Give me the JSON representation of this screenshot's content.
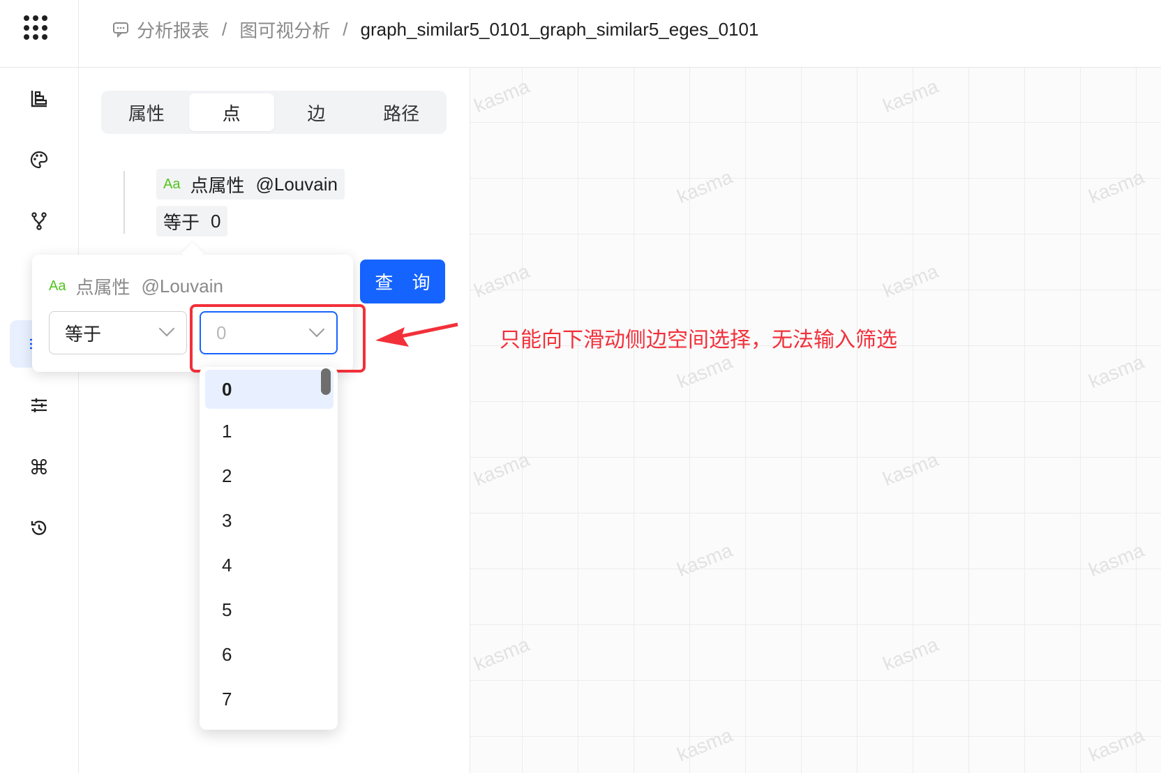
{
  "breadcrumb": {
    "items": [
      "分析报表",
      "图可视分析",
      "graph_similar5_0101_graph_similar5_eges_0101"
    ],
    "separator": "/"
  },
  "tabs": [
    "属性",
    "点",
    "边",
    "路径"
  ],
  "active_tab": "点",
  "filter": {
    "attr_icon": "Aa",
    "attr_label": "点属性",
    "attr_name": "@Louvain",
    "condition_op": "等于",
    "condition_value": "0"
  },
  "query_button": "查 询",
  "popover": {
    "title_icon": "Aa",
    "title_label": "点属性",
    "title_name": "@Louvain",
    "operator": "等于",
    "value_placeholder": "0"
  },
  "dropdown_options": [
    "0",
    "1",
    "2",
    "3",
    "4",
    "5",
    "6",
    "7"
  ],
  "annotation": "只能向下滑动侧边空间选择，无法输入筛选",
  "watermark": "kasma",
  "colors": {
    "primary": "#1664ff",
    "annotation_red": "#f2303a",
    "attr_green": "#52c41a"
  }
}
